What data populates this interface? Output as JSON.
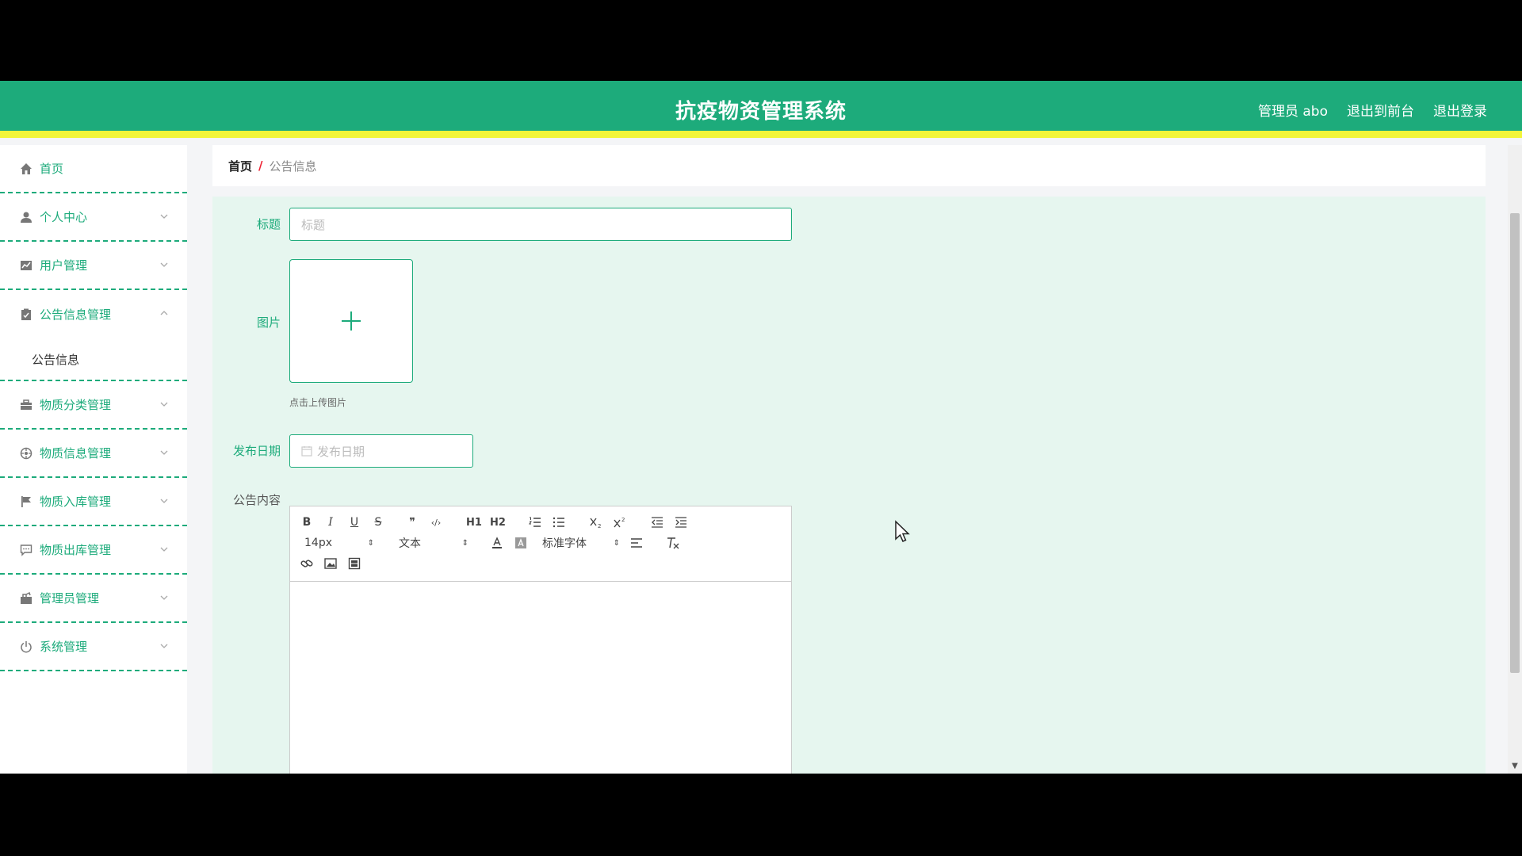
{
  "header": {
    "title": "抗疫物资管理系统",
    "user_label": "管理员 abo",
    "to_front": "退出到前台",
    "logout": "退出登录"
  },
  "sidebar": {
    "items": [
      {
        "label": "首页",
        "icon": "home-icon"
      },
      {
        "label": "个人中心",
        "icon": "user-icon"
      },
      {
        "label": "用户管理",
        "icon": "chart-icon"
      },
      {
        "label": "公告信息管理",
        "icon": "clipboard-icon"
      },
      {
        "label": "物质分类管理",
        "icon": "briefcase-icon"
      },
      {
        "label": "物质信息管理",
        "icon": "target-icon"
      },
      {
        "label": "物质入库管理",
        "icon": "flag-icon"
      },
      {
        "label": "物质出库管理",
        "icon": "message-icon"
      },
      {
        "label": "管理员管理",
        "icon": "admin-icon"
      },
      {
        "label": "系统管理",
        "icon": "power-icon"
      }
    ],
    "sub_item": "公告信息"
  },
  "breadcrumb": {
    "home": "首页",
    "separator": "/",
    "current": "公告信息"
  },
  "form": {
    "title_label": "标题",
    "title_placeholder": "标题",
    "image_label": "图片",
    "upload_hint": "点击上传图片",
    "date_label": "发布日期",
    "date_placeholder": "发布日期",
    "content_label": "公告内容"
  },
  "editor": {
    "buttons": [
      "B",
      "I",
      "U",
      "S",
      "❞",
      "‹/›",
      "H1",
      "H2"
    ],
    "size": "14px",
    "header": "文本",
    "font": "标准字体"
  },
  "colors": {
    "primary": "#1dab7b",
    "accent": "#f2f539",
    "panel": "#e6f6ef"
  }
}
